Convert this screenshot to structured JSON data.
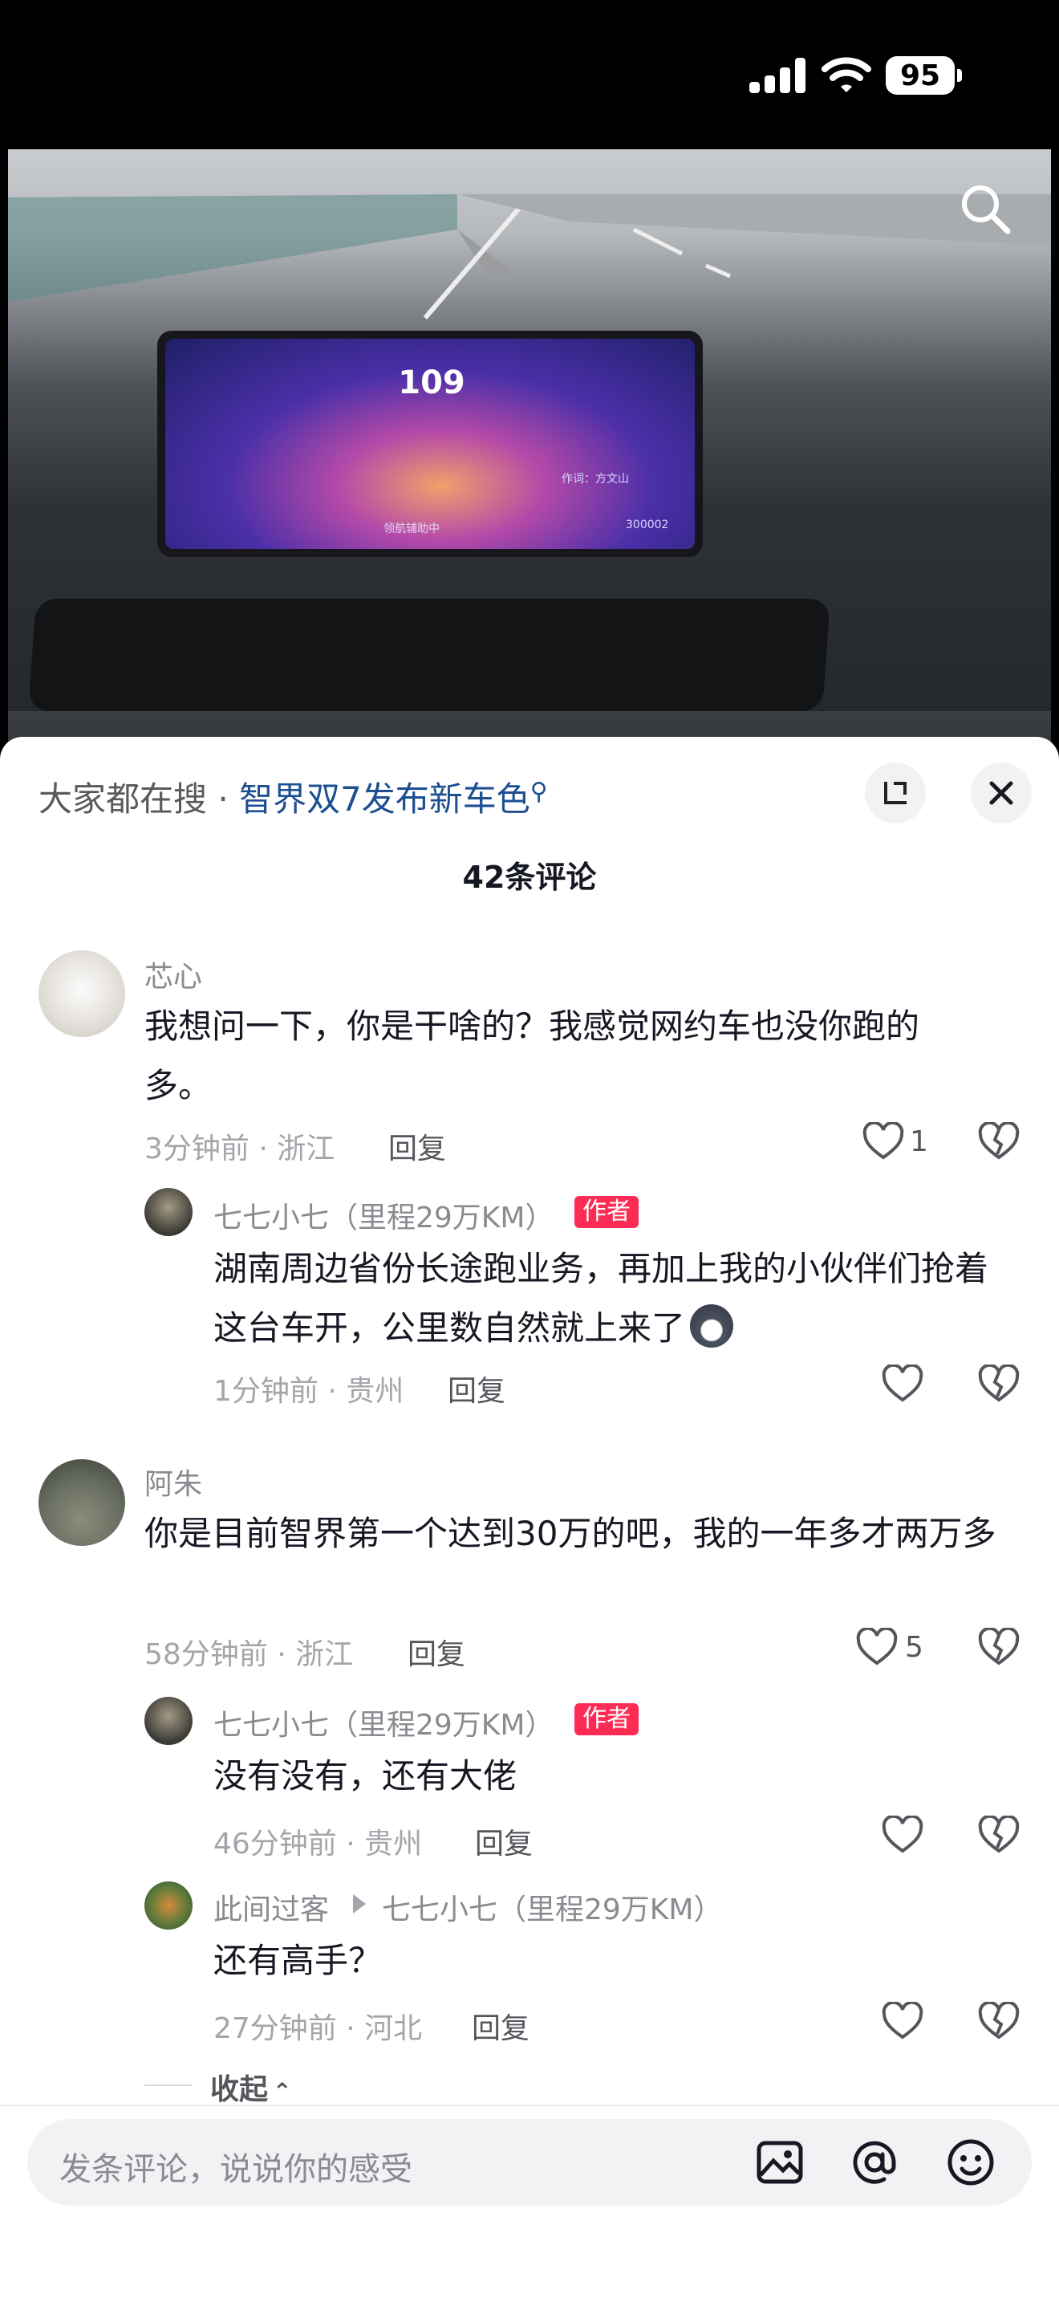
{
  "status_bar": {
    "battery": "95"
  },
  "video": {
    "speed": "109",
    "screen_lyric": "作词：方文山",
    "screen_odometer": "300002",
    "screen_status": "领航辅助中"
  },
  "hot_search": {
    "prefix": "大家都在搜 · ",
    "keyword": "智界双7发布新车色"
  },
  "comment_count": "42条评论",
  "comments": [
    {
      "user": "芯心",
      "text": "我想问一下，你是干啥的？我感觉网约车也没你跑的多。",
      "time_loc": "3分钟前 · 浙江",
      "reply": "回复",
      "likes": "1",
      "replies": [
        {
          "user": "七七小七（里程29万KM）",
          "tag": "作者",
          "text": "湖南周边省份长途跑业务，再加上我的小伙伴们抢着这台车开，公里数自然就上来了",
          "time_loc": "1分钟前 · 贵州",
          "reply": "回复"
        }
      ]
    },
    {
      "user": "阿朱",
      "text": "你是目前智界第一个达到30万的吧，我的一年多才两万多",
      "time_loc": "58分钟前 · 浙江",
      "reply": "回复",
      "likes": "5",
      "replies": [
        {
          "user": "七七小七（里程29万KM）",
          "tag": "作者",
          "text": "没有没有，还有大佬",
          "time_loc": "46分钟前 · 贵州",
          "reply": "回复"
        },
        {
          "user": "此间过客",
          "reply_to": "七七小七（里程29万KM）",
          "text": "还有高手？",
          "time_loc": "27分钟前 · 河北",
          "reply": "回复"
        }
      ]
    }
  ],
  "collapse_label": "收起",
  "input": {
    "placeholder": "发条评论，说说你的感受"
  },
  "colors": {
    "author_tag": "#fe2c55",
    "keyword": "#1d4f91"
  },
  "icons": [
    "search-icon",
    "expand-icon",
    "close-icon",
    "heart-icon",
    "broken-heart-icon",
    "image-icon",
    "at-icon",
    "emoji-icon",
    "husky-emoji-icon"
  ]
}
